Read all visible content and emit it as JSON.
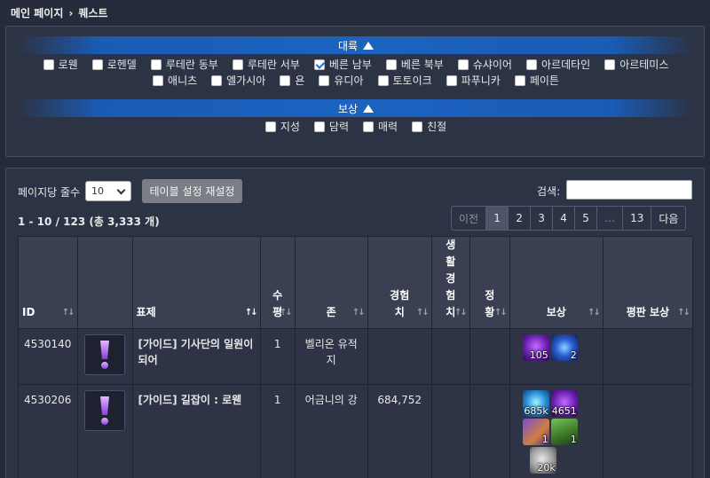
{
  "breadcrumb": {
    "home": "메인 페이지",
    "separator": "›",
    "current": "퀘스트"
  },
  "filters": {
    "continent_label": "대륙",
    "continents": [
      {
        "label": "로웬",
        "checked": false
      },
      {
        "label": "로헨델",
        "checked": false
      },
      {
        "label": "루테란 동부",
        "checked": false
      },
      {
        "label": "루테란 서부",
        "checked": false
      },
      {
        "label": "베른 남부",
        "checked": true
      },
      {
        "label": "베른 북부",
        "checked": false
      },
      {
        "label": "슈샤이어",
        "checked": false
      },
      {
        "label": "아르데타인",
        "checked": false
      },
      {
        "label": "아르테미스",
        "checked": false
      },
      {
        "label": "애니츠",
        "checked": false
      },
      {
        "label": "엘가시아",
        "checked": false
      },
      {
        "label": "욘",
        "checked": false
      },
      {
        "label": "유디아",
        "checked": false
      },
      {
        "label": "토토이크",
        "checked": false
      },
      {
        "label": "파푸니카",
        "checked": false
      },
      {
        "label": "페이튼",
        "checked": false
      }
    ],
    "reward_label": "보상",
    "rewards": [
      {
        "label": "지성",
        "checked": false
      },
      {
        "label": "담력",
        "checked": false
      },
      {
        "label": "매력",
        "checked": false
      },
      {
        "label": "친절",
        "checked": false
      }
    ]
  },
  "table_controls": {
    "rows_per_page_label": "페이지당 줄수",
    "rows_per_page_value": "10",
    "reset_button": "테이블 설정 재설정",
    "search_label": "검색:",
    "search_value": "",
    "summary": "1 - 10 / 123 (총 3,333 개)",
    "pager": {
      "prev": "이전",
      "pages": [
        "1",
        "2",
        "3",
        "4",
        "5"
      ],
      "ellipsis": "…",
      "last": "13",
      "next": "다음",
      "active": "1"
    }
  },
  "columns": {
    "id": "ID",
    "icon": "",
    "title": "표제",
    "level": "수\n평",
    "zone": "존",
    "exp": "경험\n치",
    "life_exp": "생\n활\n경\n험\n치",
    "status": "정\n황",
    "reward": "보상",
    "reputation": "평판 보상"
  },
  "rows": [
    {
      "id": "4530140",
      "title": "[가이드] 기사단의 일원이 되어",
      "level": "1",
      "zone": "벨리온 유적지",
      "exp": "",
      "life_exp": "",
      "status": "",
      "reward_items": [
        {
          "icon": "purple-gem-icon",
          "count": "105"
        },
        {
          "icon": "blue-orb-icon",
          "count": "2"
        }
      ],
      "reputation": ""
    },
    {
      "id": "4530206",
      "title": "[가이드] 길잡이 : 로웬",
      "level": "1",
      "zone": "어금니의 강",
      "exp": "684,752",
      "life_exp": "",
      "status": "",
      "reward_items": [
        {
          "icon": "cyan-gem-icon",
          "count": "685k"
        },
        {
          "icon": "purple-gem-icon",
          "count": "4651"
        },
        {
          "icon": "book-icon",
          "count": "1"
        },
        {
          "icon": "chest-icon",
          "count": "1"
        },
        {
          "icon": "silver-coin-icon",
          "count": "20k"
        }
      ],
      "reputation": ""
    }
  ]
}
